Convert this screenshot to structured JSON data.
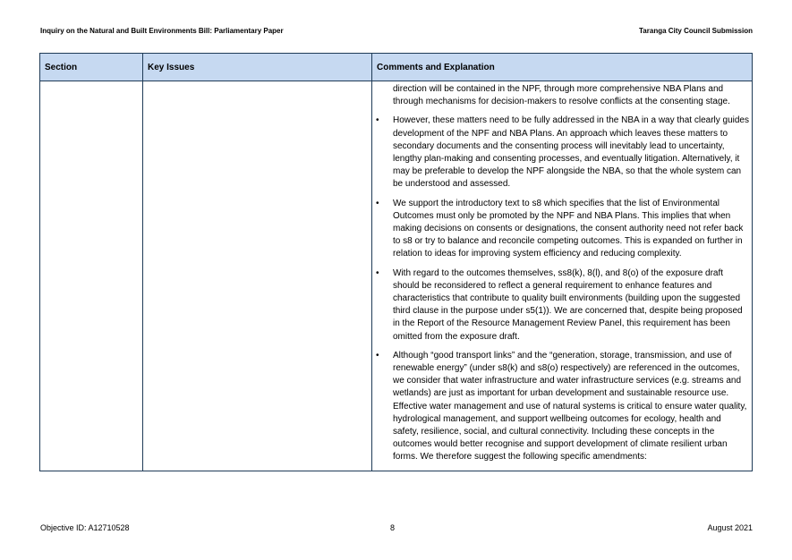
{
  "header": {
    "left": "Inquiry on the Natural and Built Environments Bill: Parliamentary Paper",
    "right": "Taranga City Council Submission"
  },
  "table": {
    "columns": [
      "Section",
      "Key Issues",
      "Comments and Explanation"
    ],
    "comments": [
      "direction will be contained in the NPF, through more comprehensive NBA Plans and through mechanisms for decision-makers to resolve conflicts at the consenting stage.",
      "However, these matters need to be fully addressed in the NBA in a way that clearly guides development of the NPF and NBA Plans.  An approach which leaves these matters to secondary documents and the consenting process will inevitably lead to uncertainty, lengthy plan-making and consenting processes, and eventually litigation.  Alternatively, it may be preferable to develop the NPF alongside the NBA, so that the whole system can be understood and assessed.",
      "We support the introductory text to s8 which specifies that the list of Environmental Outcomes must only be promoted by the NPF and NBA Plans.  This implies that when making decisions on consents or designations, the consent authority need not refer back to s8 or try to balance and reconcile competing outcomes.  This is expanded on further in relation to ideas for improving system efficiency and reducing complexity.",
      "With regard to the outcomes themselves, ss8(k), 8(l), and 8(o) of the exposure draft should be reconsidered to reflect a general requirement to enhance features and characteristics that contribute to quality built environments (building upon the suggested third clause in the purpose under s5(1)).  We are concerned that, despite being proposed in the Report of the Resource Management Review Panel, this requirement has been omitted from the exposure draft.",
      "Although “good transport links” and the “generation, storage, transmission, and use of renewable energy” (under s8(k) and s8(o) respectively) are referenced in the outcomes, we consider that water infrastructure and water infrastructure services (e.g. streams and wetlands) are just as important for urban development and sustainable resource use.  Effective water management and use of natural systems is critical to ensure water quality, hydrological management, and support wellbeing outcomes for ecology, health and safety, resilience, social, and cultural connectivity.  Including these concepts in the outcomes would better recognise and support development of climate resilient urban forms.  We therefore suggest the following specific amendments:"
    ]
  },
  "footer": {
    "left": "Objective ID: A12710528",
    "center": "8",
    "right": "August 2021"
  }
}
